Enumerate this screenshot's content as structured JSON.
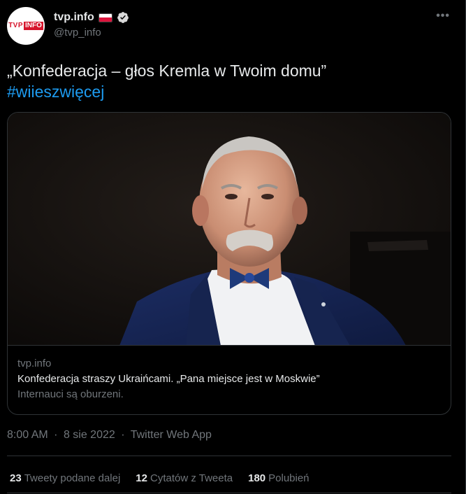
{
  "author": {
    "display_name": "tvp.info",
    "handle": "@tvp_info",
    "logo_text_a": "TVP",
    "logo_text_b": "INFO",
    "flag_icon": "poland-flag-icon",
    "verified_icon": "verified-badge-icon"
  },
  "menu": {
    "icon": "more-options-icon",
    "glyph": "•••"
  },
  "tweet": {
    "text": "„Konfederacja – głos Kremla w Twoim domu”",
    "hashtag": "#wiieszwięcej"
  },
  "card": {
    "domain": "tvp.info",
    "title": "Konfederacja straszy Ukraińcami. „Pana miejsce jest w Moskwie”",
    "description": "Internauci są oburzeni."
  },
  "meta": {
    "time": "8:00 AM",
    "date": "8 sie 2022",
    "source": "Twitter Web App",
    "separator": "·"
  },
  "stats": [
    {
      "count": "23",
      "label": "Tweety podane dalej"
    },
    {
      "count": "12",
      "label": "Cytatów z Tweeta"
    },
    {
      "count": "180",
      "label": "Polubień"
    }
  ],
  "colors": {
    "background": "#000000",
    "text": "#e7e9ea",
    "secondary": "#71767b",
    "link": "#1d9bf0",
    "border": "#2f3336",
    "brand_red": "#d6142b"
  }
}
